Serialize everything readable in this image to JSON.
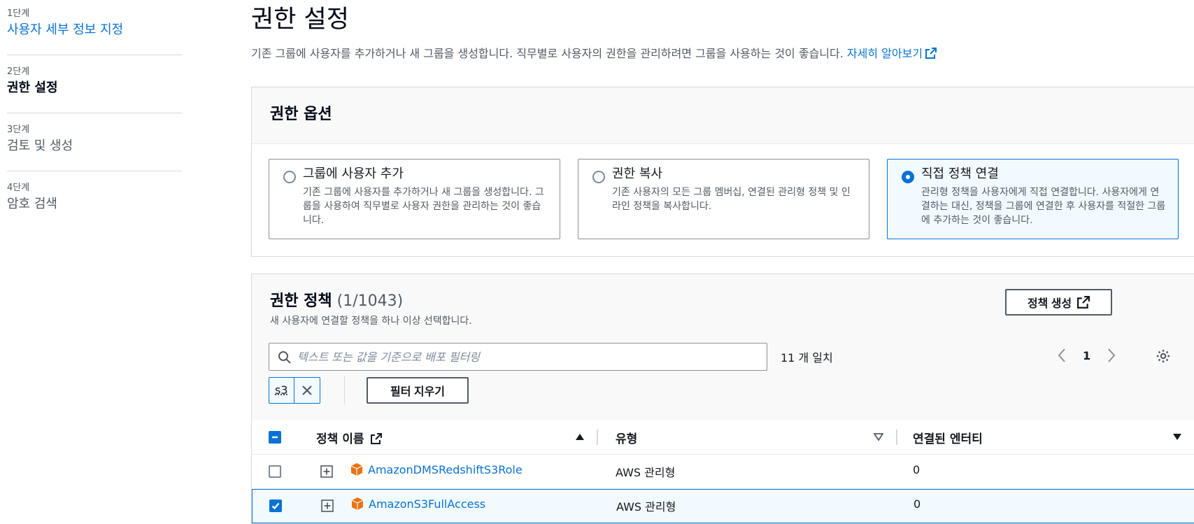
{
  "steps": [
    {
      "num": "1단계",
      "title": "사용자 세부 정보 지정",
      "state": "link"
    },
    {
      "num": "2단계",
      "title": "권한 설정",
      "state": "active"
    },
    {
      "num": "3단계",
      "title": "검토 및 생성",
      "state": "disabled"
    },
    {
      "num": "4단계",
      "title": "암호 검색",
      "state": "disabled"
    }
  ],
  "page": {
    "title": "권한 설정",
    "description": "기존 그룹에 사용자를 추가하거나 새 그룹을 생성합니다. 직무별로 사용자의 권한을 관리하려면 그룹을 사용하는 것이 좋습니다.",
    "learn_more": "자세히 알아보기"
  },
  "options": {
    "title": "권한 옵션",
    "tiles": [
      {
        "title": "그룹에 사용자 추가",
        "desc": "기존 그룹에 사용자를 추가하거나 새 그룹을 생성합니다. 그룹을 사용하여 직무별로 사용자 권한을 관리하는 것이 좋습니다.",
        "selected": false
      },
      {
        "title": "권한 복사",
        "desc": "기존 사용자의 모든 그룹 멤버십, 연결된 관리형 정책 및 인라인 정책을 복사합니다.",
        "selected": false
      },
      {
        "title": "직접 정책 연결",
        "desc": "관리형 정책을 사용자에게 직접 연결합니다. 사용자에게 연결하는 대신, 정책을 그룹에 연결한 후 사용자를 적절한 그룹에 추가하는 것이 좋습니다.",
        "selected": true
      }
    ]
  },
  "policies": {
    "title": "권한 정책",
    "count": "(1/1043)",
    "description": "새 사용자에 연결할 정책을 하나 이상 선택합니다.",
    "create_label": "정책 생성",
    "search_placeholder": "텍스트 또는 값을 기준으로 배포 필터링",
    "search_value": "",
    "match_count": "11 개 일치",
    "current_page": "1",
    "filter_token": "s3",
    "clear_filter_label": "필터 지우기",
    "columns": {
      "name": "정책 이름",
      "type": "유형",
      "entities": "연결된 엔터티"
    },
    "rows": [
      {
        "name": "AmazonDMSRedshiftS3Role",
        "type": "AWS 관리형",
        "entities": "0",
        "checked": false
      },
      {
        "name": "AmazonS3FullAccess",
        "type": "AWS 관리형",
        "entities": "0",
        "checked": true
      }
    ]
  },
  "colors": {
    "accent": "#0972d3",
    "selected_bg": "#f1faff",
    "aws_orange": "#ec7211"
  }
}
